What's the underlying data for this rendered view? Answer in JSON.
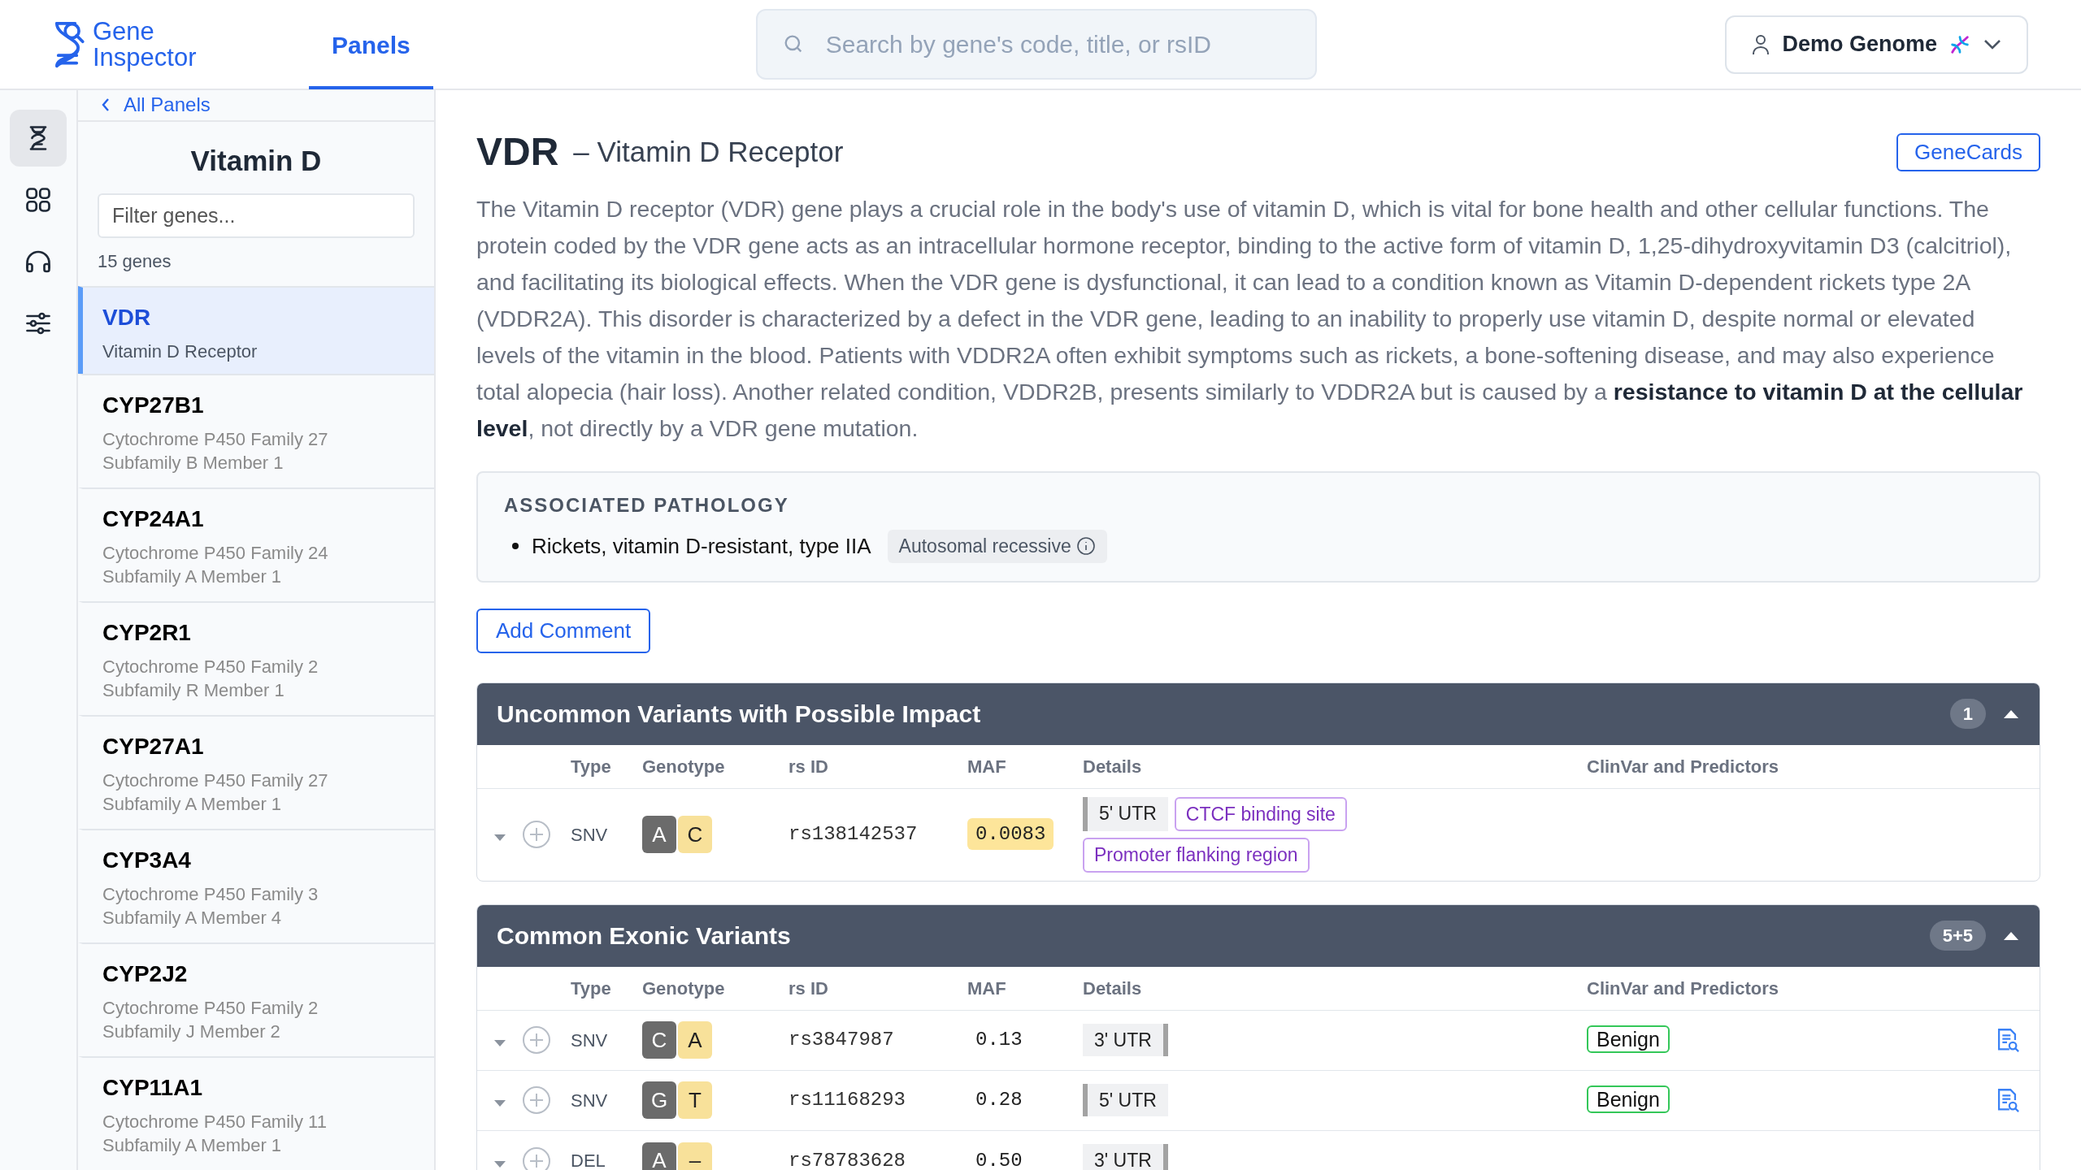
{
  "logo": "Gene Inspector",
  "nav_tabs": [
    {
      "label": "Panels",
      "selected": true
    }
  ],
  "search": {
    "placeholder": "Search by gene's code, title, or rsID"
  },
  "profile": {
    "label": "Demo Genome"
  },
  "rail_items": [
    {
      "selected": true
    },
    {
      "selected": false
    },
    {
      "selected": false
    },
    {
      "selected": false
    }
  ],
  "gene_panel": {
    "back_link": "All Panels",
    "title": "Vitamin D",
    "filter": {
      "placeholder": "Filter genes..."
    },
    "count": "15 genes",
    "genes": [
      {
        "symbol": "VDR",
        "name": "Vitamin D Receptor",
        "selected": true
      },
      {
        "symbol": "CYP27B1",
        "name": "Cytochrome P450 Family 27 Subfamily B Member 1",
        "selected": false
      },
      {
        "symbol": "CYP24A1",
        "name": "Cytochrome P450 Family 24 Subfamily A Member 1",
        "selected": false
      },
      {
        "symbol": "CYP2R1",
        "name": "Cytochrome P450 Family 2 Subfamily R Member 1",
        "selected": false
      },
      {
        "symbol": "CYP27A1",
        "name": "Cytochrome P450 Family 27 Subfamily A Member 1",
        "selected": false
      },
      {
        "symbol": "CYP3A4",
        "name": "Cytochrome P450 Family 3 Subfamily A Member 4",
        "selected": false
      },
      {
        "symbol": "CYP2J2",
        "name": "Cytochrome P450 Family 2 Subfamily J Member 2",
        "selected": false
      },
      {
        "symbol": "CYP11A1",
        "name": "Cytochrome P450 Family 11 Subfamily A Member 1",
        "selected": false
      }
    ]
  },
  "gene": {
    "symbol": "VDR",
    "title": "– Vitamin D Receptor",
    "link": "GeneCards",
    "description": "The Vitamin D receptor (VDR) gene plays a crucial role in the body's use of vitamin D, which is vital for bone health and other cellular functions. The protein coded by the VDR gene acts as an intracellular hormone receptor, binding to the active form of vitamin D, 1,25-dihydroxyvitamin D3 (calcitriol), and facilitating its biological effects. When the VDR gene is dysfunctional, it can lead to a condition known as Vitamin D-dependent rickets type 2A (VDDR2A). This disorder is characterized by a defect in the VDR gene, leading to an inability to properly use vitamin D, despite normal or elevated levels of the vitamin in the blood. Patients with VDDR2A often exhibit symptoms such as rickets, a bone-softening disease, and may also experience total alopecia (hair loss). Another related condition, VDDR2B, presents similarly to VDDR2A but is caused by a **resistance to vitamin D at the cellular level**, not directly by a VDR gene mutation."
  },
  "pathology": {
    "heading": "ASSOCIATED PATHOLOGY",
    "items": [
      {
        "name": "Rickets, vitamin D-resistant, type IIA",
        "inheritance": "Autosomal recessive"
      }
    ]
  },
  "add_comment": "Add Comment",
  "sections": [
    {
      "title": "Uncommon Variants with Possible Impact",
      "count": "1",
      "expanded": true,
      "columns": [
        "Type",
        "Genotype",
        "rs ID",
        "MAF",
        "Details",
        "ClinVar and Predictors"
      ],
      "rows": [
        {
          "type": "SNV",
          "genotype": [
            "A",
            "C"
          ],
          "rsid": "rs138142537",
          "maf": "0.0083",
          "maf_highlighted": true,
          "details": [
            {
              "label": "5' UTR",
              "kind": "region",
              "bar_left": true
            },
            {
              "label": "CTCF binding site",
              "kind": "feature"
            },
            {
              "label": "Promoter flanking region",
              "kind": "feature"
            }
          ]
        }
      ]
    },
    {
      "title": "Common Exonic Variants",
      "count": "5+5",
      "expanded": true,
      "columns": [
        "Type",
        "Genotype",
        "rs ID",
        "MAF",
        "Details",
        "ClinVar and Predictors"
      ],
      "rows": [
        {
          "type": "SNV",
          "genotype": [
            "C",
            "A"
          ],
          "rsid": "rs3847987",
          "maf": "0.13",
          "maf_highlighted": false,
          "details": [
            {
              "label": "3' UTR",
              "kind": "region",
              "bar_left": false
            }
          ],
          "clinvar": "Benign",
          "report": true
        },
        {
          "type": "SNV",
          "genotype": [
            "G",
            "T"
          ],
          "rsid": "rs11168293",
          "maf": "0.28",
          "maf_highlighted": false,
          "details": [
            {
              "label": "5' UTR",
              "kind": "region",
              "bar_left": true
            }
          ],
          "clinvar": "Benign",
          "report": true
        },
        {
          "type": "DEL",
          "genotype": [
            "A",
            "–"
          ],
          "rsid": "rs78783628",
          "maf": "0.50",
          "maf_highlighted": false,
          "details": [
            {
              "label": "3' UTR",
              "kind": "region",
              "bar_left": false
            }
          ]
        }
      ]
    }
  ]
}
